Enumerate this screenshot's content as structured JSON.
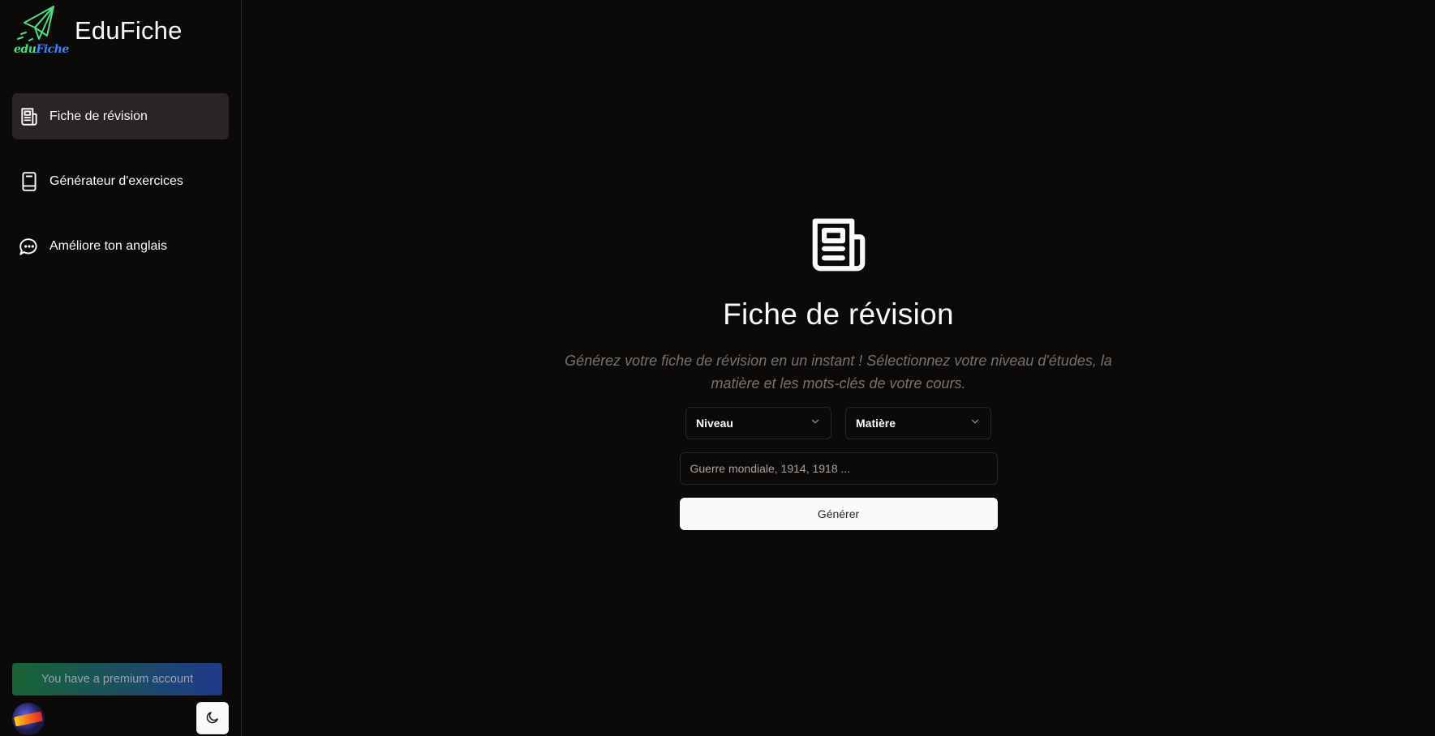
{
  "brand": {
    "logo_word_1": "edu",
    "logo_word_2": "Fiche",
    "name": "EduFiche"
  },
  "sidebar": {
    "items": [
      {
        "label": "Fiche de révision",
        "icon": "newspaper-icon",
        "active": true
      },
      {
        "label": "Générateur d'exercices",
        "icon": "book-icon",
        "active": false
      },
      {
        "label": "Améliore ton anglais",
        "icon": "chat-bubble-icon",
        "active": false
      }
    ],
    "premium_label": "You have a premium account",
    "theme_icon": "moon-icon"
  },
  "main": {
    "hero_icon": "newspaper-icon",
    "title": "Fiche de révision",
    "subtitle": "Générez votre fiche de révision en un instant ! Sélectionnez votre niveau d'études, la matière et les mots-clés de votre cours.",
    "level_select": "Niveau",
    "subject_select": "Matière",
    "keywords_placeholder": "Guerre mondiale, 1914, 1918 ...",
    "generate_label": "Générer"
  },
  "colors": {
    "background": "#0c0a09",
    "active_item": "#292524",
    "premium_gradient_start": "#166534",
    "premium_gradient_end": "#1e3a8a",
    "logo_green": "#4ade80",
    "logo_blue": "#3b82f6"
  }
}
